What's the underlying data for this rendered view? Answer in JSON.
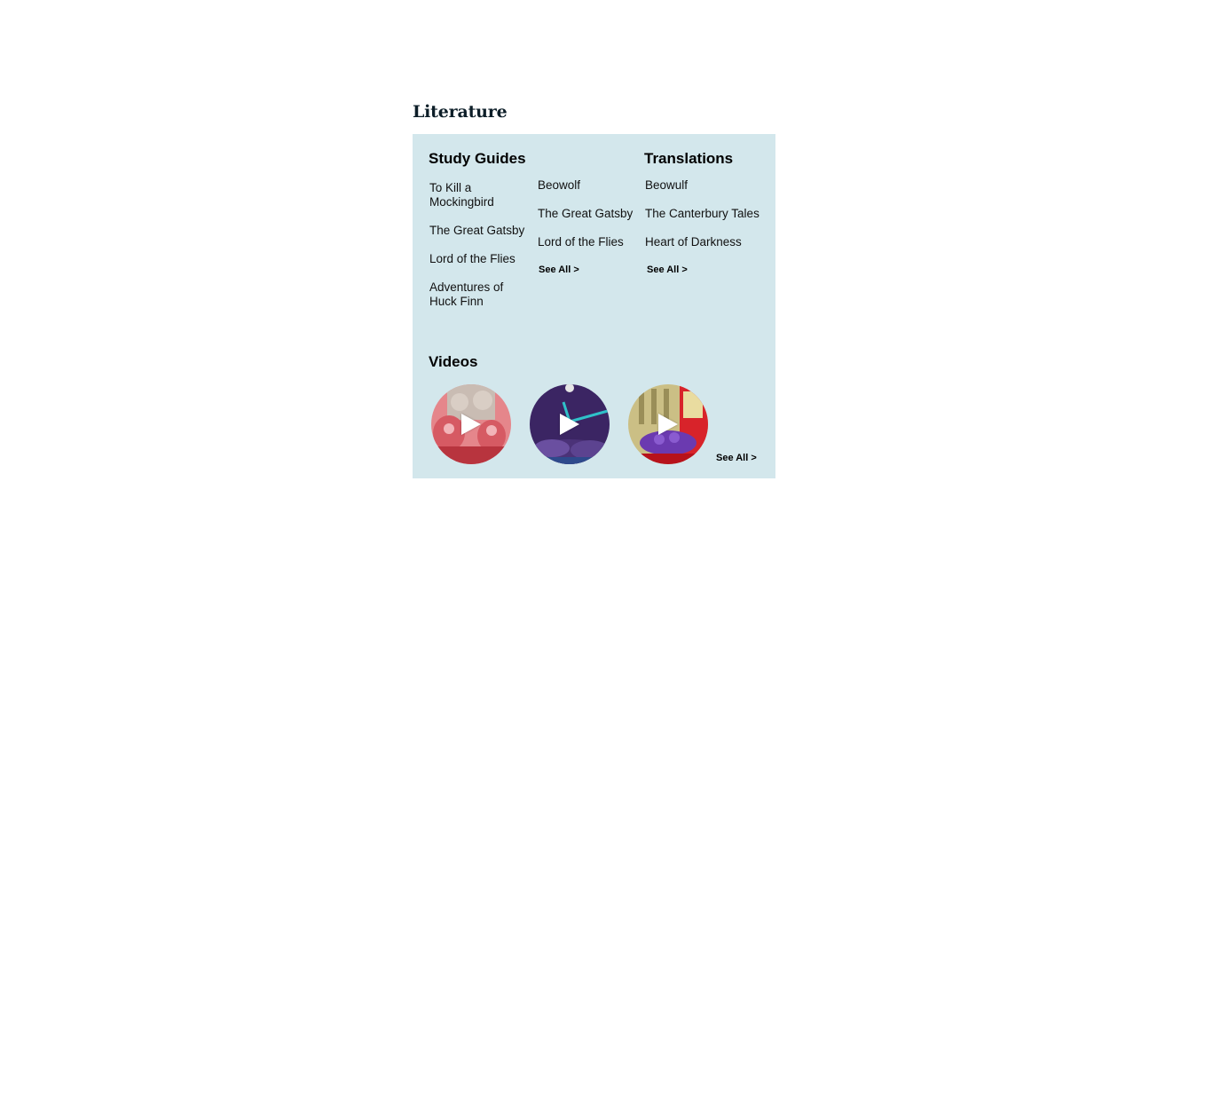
{
  "page": {
    "title": "Literature"
  },
  "study_guides": {
    "heading": "Study Guides",
    "column_1": [
      "To Kill a Mockingbird",
      "The Great Gatsby",
      "Lord of the Flies",
      "Adventures of Huck Finn"
    ],
    "column_2": [
      "Beowolf",
      "The Great Gatsby",
      "Lord of the Flies"
    ],
    "see_all": "See All >"
  },
  "translations": {
    "heading": "Translations",
    "items": [
      "Beowulf",
      "The Canterbury Tales",
      "Heart of Darkness"
    ],
    "see_all": "See All >"
  },
  "videos": {
    "heading": "Videos",
    "thumbnails": [
      {
        "icon": "play-icon",
        "palette": [
          "#e07a80",
          "#c9b8ae",
          "#b8343e"
        ]
      },
      {
        "icon": "play-icon",
        "palette": [
          "#3a2560",
          "#2fc1c9",
          "#5a3a8a"
        ]
      },
      {
        "icon": "play-icon",
        "palette": [
          "#c9bd83",
          "#6b3ab0",
          "#d8232a"
        ]
      }
    ],
    "see_all": "See All >"
  },
  "colors": {
    "panel_background": "#d3e7ec",
    "heading_text": "#0d1e28"
  }
}
